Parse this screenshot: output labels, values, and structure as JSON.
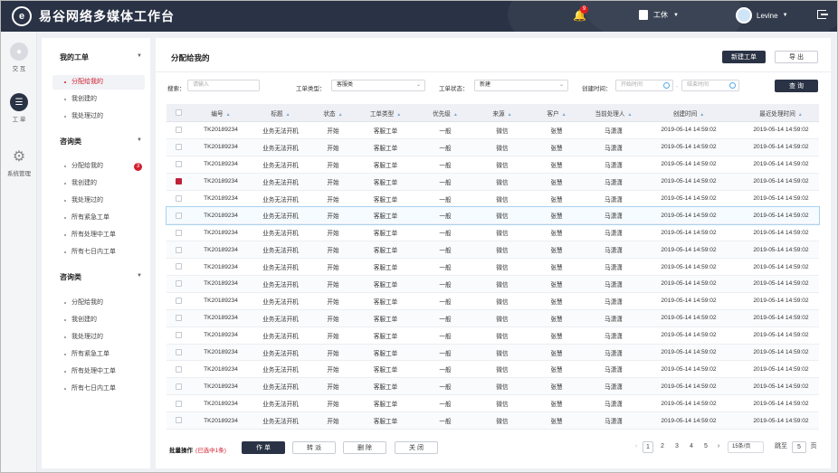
{
  "app": {
    "title": "易谷网络多媒体工作台",
    "logo_glyph": "e"
  },
  "header": {
    "notification_count": "9",
    "status_label": "工休",
    "user_name": "Levine"
  },
  "rail": [
    {
      "label": "交 互",
      "icon": "chat-icon"
    },
    {
      "label": "工 单",
      "icon": "layers-icon"
    },
    {
      "label": "系统管理",
      "icon": "gear-icon"
    }
  ],
  "subnav": {
    "groups": [
      {
        "title": "我的工单",
        "items": [
          "分配给我的",
          "我创建的",
          "我处理过的"
        ]
      },
      {
        "title": "咨询类",
        "items": [
          "分配给我的",
          "我创建的",
          "我处理过的",
          "所有紧急工单",
          "所有处理中工单",
          "所有七日内工单"
        ],
        "badge": "3"
      },
      {
        "title": "咨询类",
        "items": [
          "分配给我的",
          "我创建的",
          "我处理过的",
          "所有紧急工单",
          "所有处理中工单",
          "所有七日内工单"
        ]
      }
    ]
  },
  "main": {
    "title": "分配给我的",
    "new_button": "新建工单",
    "export_button": "导 出",
    "filters": {
      "search_label": "搜索：",
      "search_placeholder": "请输入",
      "type_label": "工单类型：",
      "type_value": "客服类",
      "status_label": "工单状态：",
      "status_value": "新建",
      "time_label": "创建时间：",
      "start_placeholder": "开始时间",
      "end_placeholder": "结束时间",
      "query_button": "查 询"
    },
    "columns": [
      "编号",
      "标题",
      "状态",
      "工单类型",
      "优先级",
      "来源",
      "客户",
      "当前处理人",
      "创建时间",
      "最近处理时间"
    ],
    "rows": [
      [
        "TK20189234",
        "业务无法开机",
        "开始",
        "客服工单",
        "一般",
        "微信",
        "张慧",
        "马潇潇",
        "2019-05-14  14:59:02",
        "2019-05-14  14:59:02"
      ],
      [
        "TK20189234",
        "业务无法开机",
        "开始",
        "客服工单",
        "一般",
        "微信",
        "张慧",
        "马潇潇",
        "2019-05-14  14:59:02",
        "2019-05-14  14:59:02"
      ],
      [
        "TK20189234",
        "业务无法开机",
        "开始",
        "客服工单",
        "一般",
        "微信",
        "张慧",
        "马潇潇",
        "2019-05-14  14:59:02",
        "2019-05-14  14:59:02"
      ],
      [
        "TK20189234",
        "业务无法开机",
        "开始",
        "客服工单",
        "一般",
        "微信",
        "张慧",
        "马潇潇",
        "2019-05-14  14:59:02",
        "2019-05-14  14:59:02"
      ],
      [
        "TK20189234",
        "业务无法开机",
        "开始",
        "客服工单",
        "一般",
        "微信",
        "张慧",
        "马潇潇",
        "2019-05-14  14:59:02",
        "2019-05-14  14:59:02"
      ],
      [
        "TK20189234",
        "业务无法开机",
        "开始",
        "客服工单",
        "一般",
        "微信",
        "张慧",
        "马潇潇",
        "2019-05-14  14:59:02",
        "2019-05-14  14:59:02"
      ],
      [
        "TK20189234",
        "业务无法开机",
        "开始",
        "客服工单",
        "一般",
        "微信",
        "张慧",
        "马潇潇",
        "2019-05-14  14:59:02",
        "2019-05-14  14:59:02"
      ],
      [
        "TK20189234",
        "业务无法开机",
        "开始",
        "客服工单",
        "一般",
        "微信",
        "张慧",
        "马潇潇",
        "2019-05-14  14:59:02",
        "2019-05-14  14:59:02"
      ],
      [
        "TK20189234",
        "业务无法开机",
        "开始",
        "客服工单",
        "一般",
        "微信",
        "张慧",
        "马潇潇",
        "2019-05-14  14:59:02",
        "2019-05-14  14:59:02"
      ],
      [
        "TK20189234",
        "业务无法开机",
        "开始",
        "客服工单",
        "一般",
        "微信",
        "张慧",
        "马潇潇",
        "2019-05-14  14:59:02",
        "2019-05-14  14:59:02"
      ],
      [
        "TK20189234",
        "业务无法开机",
        "开始",
        "客服工单",
        "一般",
        "微信",
        "张慧",
        "马潇潇",
        "2019-05-14  14:59:02",
        "2019-05-14  14:59:02"
      ],
      [
        "TK20189234",
        "业务无法开机",
        "开始",
        "客服工单",
        "一般",
        "微信",
        "张慧",
        "马潇潇",
        "2019-05-14  14:59:02",
        "2019-05-14  14:59:02"
      ],
      [
        "TK20189234",
        "业务无法开机",
        "开始",
        "客服工单",
        "一般",
        "微信",
        "张慧",
        "马潇潇",
        "2019-05-14  14:59:02",
        "2019-05-14  14:59:02"
      ],
      [
        "TK20189234",
        "业务无法开机",
        "开始",
        "客服工单",
        "一般",
        "微信",
        "张慧",
        "马潇潇",
        "2019-05-14  14:59:02",
        "2019-05-14  14:59:02"
      ],
      [
        "TK20189234",
        "业务无法开机",
        "开始",
        "客服工单",
        "一般",
        "微信",
        "张慧",
        "马潇潇",
        "2019-05-14  14:59:02",
        "2019-05-14  14:59:02"
      ],
      [
        "TK20189234",
        "业务无法开机",
        "开始",
        "客服工单",
        "一般",
        "微信",
        "张慧",
        "马潇潇",
        "2019-05-14  14:59:02",
        "2019-05-14  14:59:02"
      ],
      [
        "TK20189234",
        "业务无法开机",
        "开始",
        "客服工单",
        "一般",
        "微信",
        "张慧",
        "马潇潇",
        "2019-05-14  14:59:02",
        "2019-05-14  14:59:02"
      ],
      [
        "TK20189234",
        "业务无法开机",
        "开始",
        "客服工单",
        "一般",
        "微信",
        "张慧",
        "马潇潇",
        "2019-05-14  14:59:02",
        "2019-05-14  14:59:02"
      ]
    ],
    "checked_row": 3,
    "highlighted_row": 5,
    "batch": {
      "label": "批量操作",
      "selected_text": "(已选中1条)",
      "buttons": [
        "作 单",
        "转 派",
        "删 除",
        "关 闭"
      ]
    },
    "pagination": {
      "pages": [
        "1",
        "2",
        "3",
        "4",
        "5"
      ],
      "current": "1",
      "page_size": "15条/页",
      "goto_label": "跳至",
      "goto_value": "5",
      "goto_suffix": "页"
    }
  },
  "colors": {
    "header_bg": "#2a3345",
    "accent_red": "#d01f2f"
  }
}
